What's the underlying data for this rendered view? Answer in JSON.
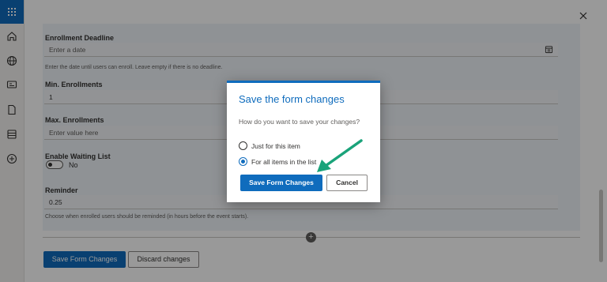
{
  "colors": {
    "accent": "#0f6cbd",
    "annotation_arrow": "#1aa37a"
  },
  "rail": {
    "icons": [
      "app-launcher-icon",
      "home-icon",
      "globe-icon",
      "news-icon",
      "document-icon",
      "list-icon",
      "add-circle-icon"
    ]
  },
  "panel": {
    "close_icon": "close-icon"
  },
  "form": {
    "enrollment_deadline": {
      "label": "Enrollment Deadline",
      "placeholder": "Enter a date",
      "hint": "Enter the date until users can enroll. Leave empty if there is no deadline."
    },
    "min_enrollments": {
      "label": "Min. Enrollments",
      "value": "1"
    },
    "max_enrollments": {
      "label": "Max. Enrollments",
      "placeholder": "Enter value here"
    },
    "waiting_list": {
      "label": "Enable Waiting List",
      "state": "No"
    },
    "reminder": {
      "label": "Reminder",
      "value": "0.25",
      "hint": "Choose when enrolled users should be reminded (in hours before the event starts)."
    },
    "save_label": "Save Form Changes",
    "discard_label": "Discard changes"
  },
  "dialog": {
    "title": "Save the form changes",
    "question": "How do you want to save your changes?",
    "options": [
      {
        "label": "Just for this item",
        "selected": false
      },
      {
        "label": "For all items in the list",
        "selected": true
      }
    ],
    "primary_label": "Save Form Changes",
    "cancel_label": "Cancel"
  }
}
